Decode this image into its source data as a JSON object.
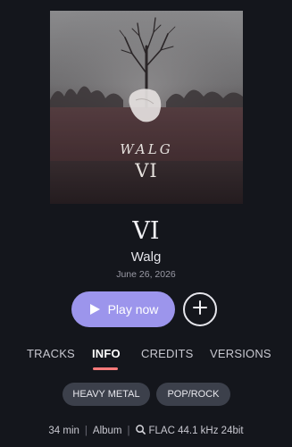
{
  "album": {
    "cover_band_text": "WALG",
    "cover_number_text": "VI",
    "title": "VI",
    "artist": "Walg",
    "release_date": "June 26, 2026"
  },
  "actions": {
    "play_label": "Play now",
    "add_icon": "plus-icon"
  },
  "tabs": [
    {
      "label": "TRACKS",
      "active": false
    },
    {
      "label": "INFO",
      "active": true
    },
    {
      "label": "CREDITS",
      "active": false
    },
    {
      "label": "VERSIONS",
      "active": false
    }
  ],
  "genres": [
    "HEAVY METAL",
    "POP/ROCK"
  ],
  "meta": {
    "duration": "34 min",
    "separator": "|",
    "type": "Album",
    "quality": "FLAC 44.1 kHz 24bit",
    "quality_icon": "hi-res-icon"
  },
  "colors": {
    "background": "#14161c",
    "accent": "#9c95ec",
    "tab_underline": "#ff7b7b",
    "chip": "#3c404b"
  }
}
